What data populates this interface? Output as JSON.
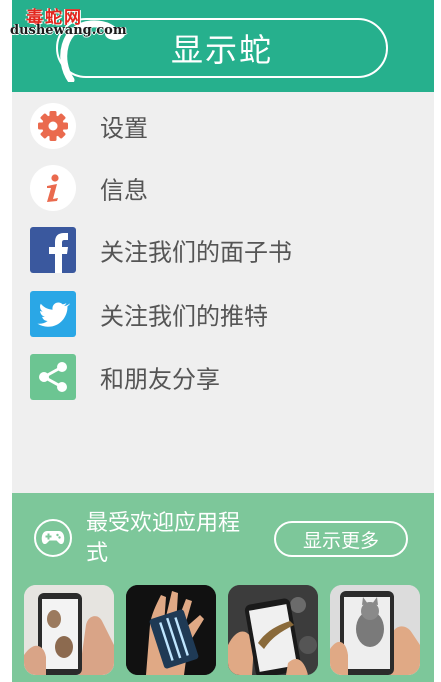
{
  "watermark": {
    "cn": "毒蛇网",
    "en": "dushewang.com"
  },
  "header": {
    "title": "显示蛇"
  },
  "menu": {
    "items": [
      {
        "label": "设置",
        "icon": "gear-icon"
      },
      {
        "label": "信息",
        "icon": "info-icon"
      },
      {
        "label": "关注我们的面子书",
        "icon": "facebook-icon"
      },
      {
        "label": "关注我们的推特",
        "icon": "twitter-icon"
      },
      {
        "label": "和朋友分享",
        "icon": "share-icon"
      }
    ]
  },
  "popular": {
    "title": "最受欢迎应用程式",
    "more_label": "显示更多",
    "icon": "gamepad-icon",
    "apps": [
      {
        "icon": "mouse-app-icon"
      },
      {
        "icon": "xray-app-icon"
      },
      {
        "icon": "lizard-app-icon"
      },
      {
        "icon": "cat-app-icon"
      }
    ]
  },
  "colors": {
    "header": "#26b08d",
    "menu_bg": "#efefef",
    "popular_bg": "#7dc79a",
    "gear": "#ea6a4e",
    "info": "#ea6a4e",
    "facebook": "#3a589e",
    "twitter": "#2aa7e6",
    "share": "#6cc592",
    "watermark_red": "#e2271f"
  }
}
